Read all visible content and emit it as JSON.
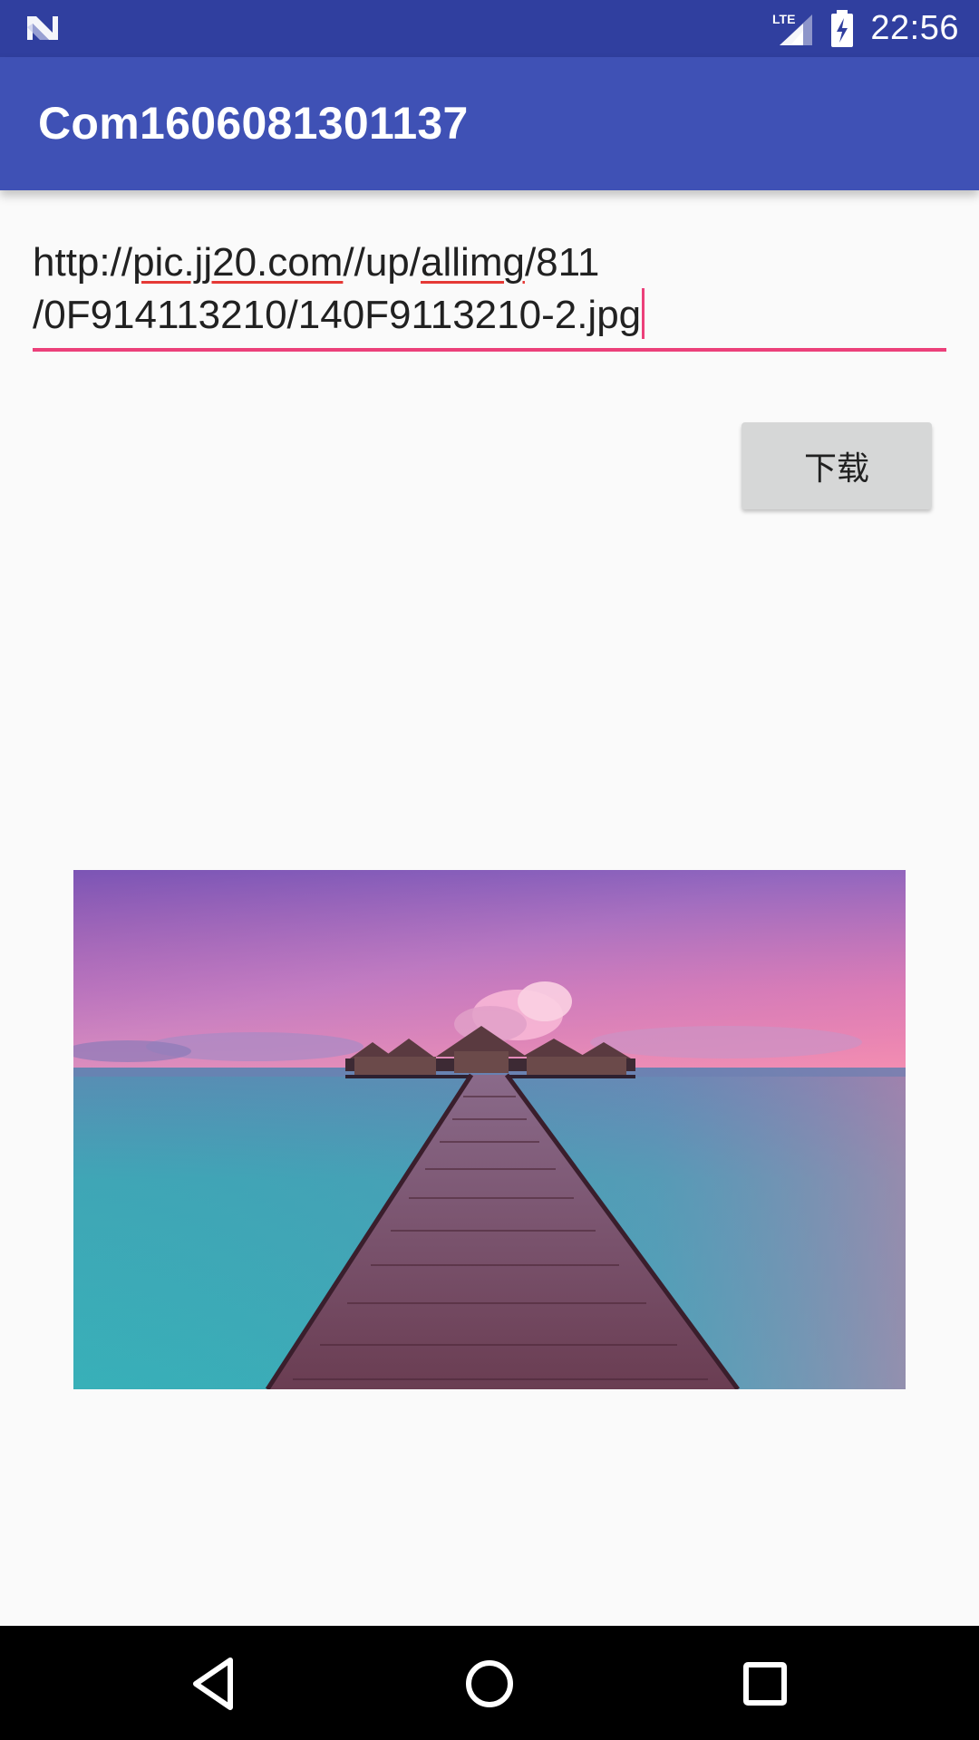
{
  "status_bar": {
    "time": "22:56",
    "network": "LTE",
    "icons": [
      "n-logo-icon",
      "lte-signal-icon",
      "battery-charging-icon"
    ]
  },
  "app_bar": {
    "title": "Com1606081301137"
  },
  "url_input": {
    "line1_prefix": "http://",
    "line1_word1": "pic.jj20.com",
    "line1_mid": "//up/",
    "line1_word2": "allimg",
    "line1_suffix": "/811",
    "line2": "/0F914113210/140F9113210-2.jpg",
    "accent_color": "#ec407a"
  },
  "download_button": {
    "label": "下载"
  },
  "image": {
    "icon": "pier-sunset-photo"
  },
  "nav_bar": {
    "icons": [
      "back-icon",
      "home-icon",
      "recents-icon"
    ]
  },
  "colors": {
    "status_bar": "#303f9f",
    "app_bar": "#3f51b5",
    "background": "#fafafa"
  }
}
